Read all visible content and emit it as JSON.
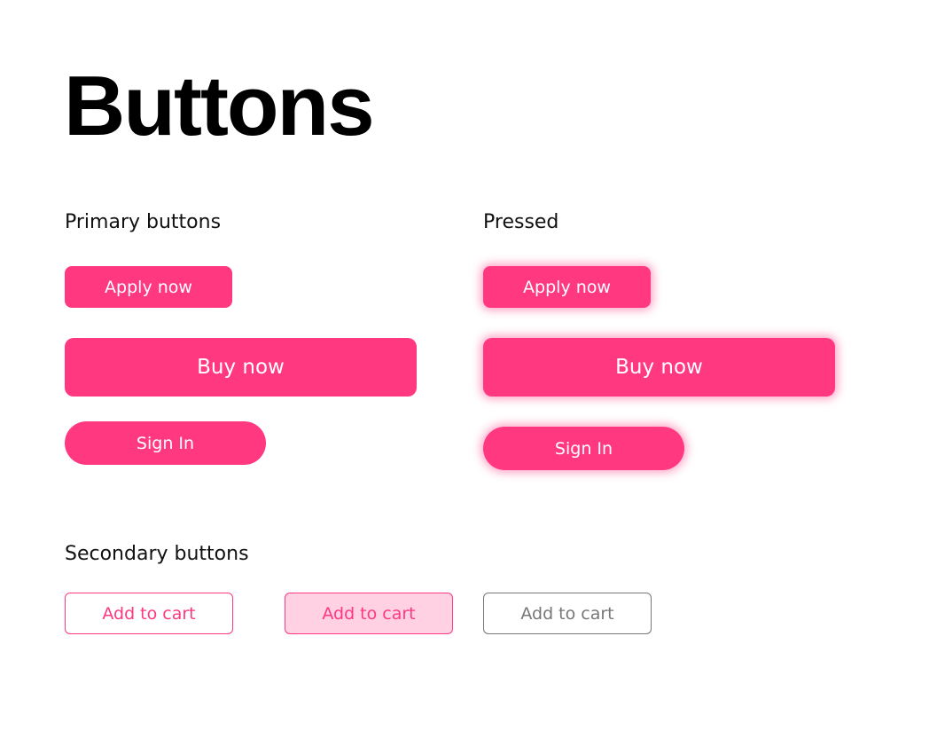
{
  "page": {
    "title": "Buttons"
  },
  "colors": {
    "primary": "#ff3880",
    "primary_light": "#ffd1e2",
    "neutral": "#777777",
    "on_primary": "#ffffff"
  },
  "primary_section": {
    "label": "Primary buttons",
    "buttons": [
      {
        "label": "Apply now",
        "variant": "small"
      },
      {
        "label": "Buy now",
        "variant": "large"
      },
      {
        "label": "Sign In",
        "variant": "pill"
      }
    ]
  },
  "pressed_section": {
    "label": "Pressed",
    "buttons": [
      {
        "label": "Apply now",
        "variant": "small"
      },
      {
        "label": "Buy now",
        "variant": "large"
      },
      {
        "label": "Sign In",
        "variant": "pill"
      }
    ]
  },
  "secondary_section": {
    "label": "Secondary buttons",
    "buttons": [
      {
        "label": "Add to cart",
        "state": "default"
      },
      {
        "label": "Add to cart",
        "state": "hover"
      },
      {
        "label": "Add to cart",
        "state": "disabled"
      }
    ]
  }
}
